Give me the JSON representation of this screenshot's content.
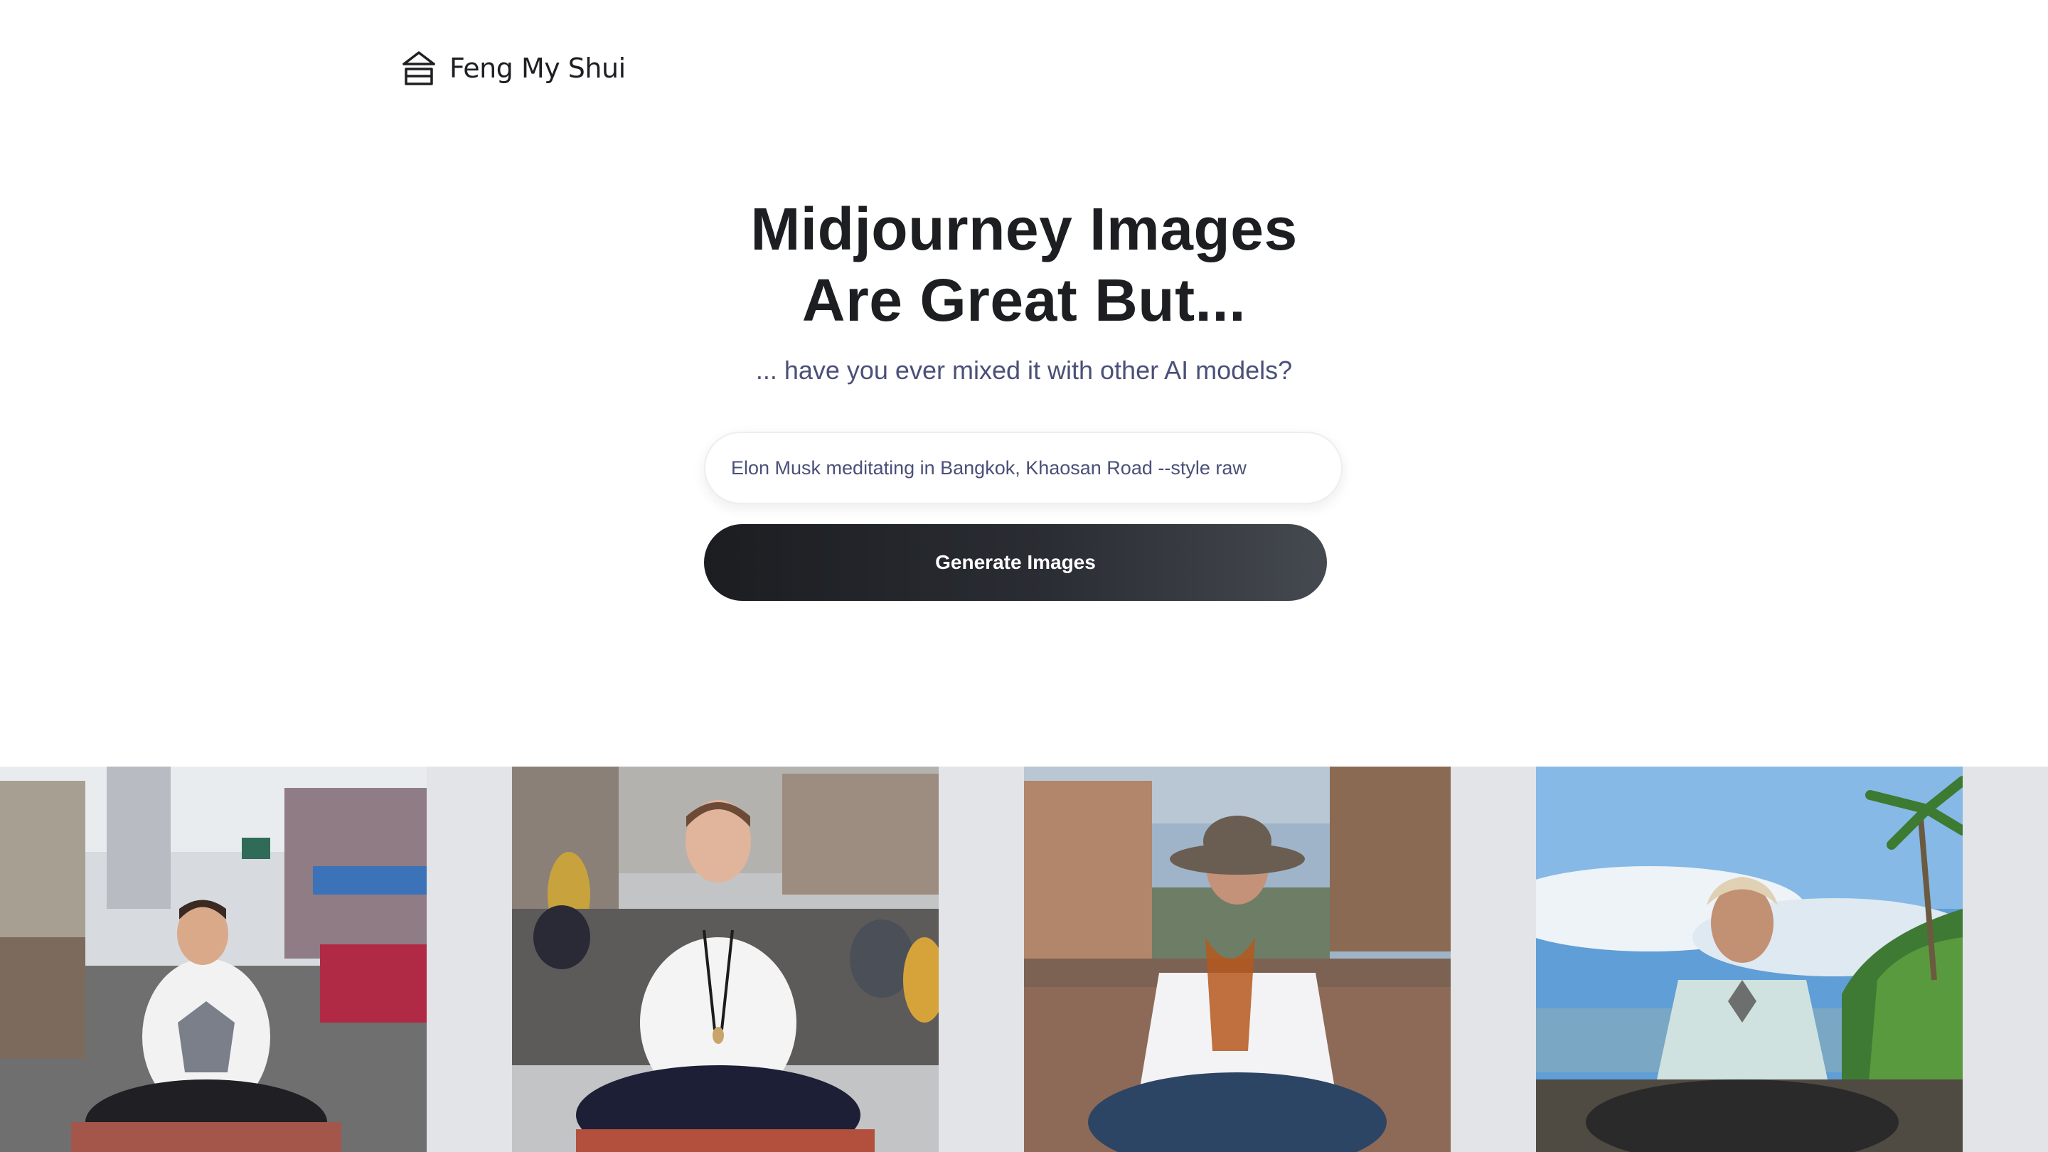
{
  "brand": {
    "name": "Feng My Shui",
    "icon": "house-outline-icon"
  },
  "hero": {
    "title_line1": "Midjourney Images",
    "title_line2": "Are Great But...",
    "subtitle": "... have you ever mixed it with other AI models?"
  },
  "prompt": {
    "value": "Elon Musk meditating in Bangkok, Khaosan Road --style raw"
  },
  "actions": {
    "generate_label": "Generate Images"
  },
  "gallery": {
    "images": [
      {
        "icon": "photo-street-meditation-1"
      },
      {
        "icon": "photo-street-meditation-2"
      },
      {
        "icon": "photo-street-meditation-3"
      },
      {
        "icon": "photo-beach-meditation-4"
      }
    ]
  },
  "colors": {
    "title": "#1c1e21",
    "subtitle": "#4b5079",
    "button_start": "#1b1d21",
    "button_end": "#454950",
    "gallery_bg": "#e2e4e7"
  }
}
